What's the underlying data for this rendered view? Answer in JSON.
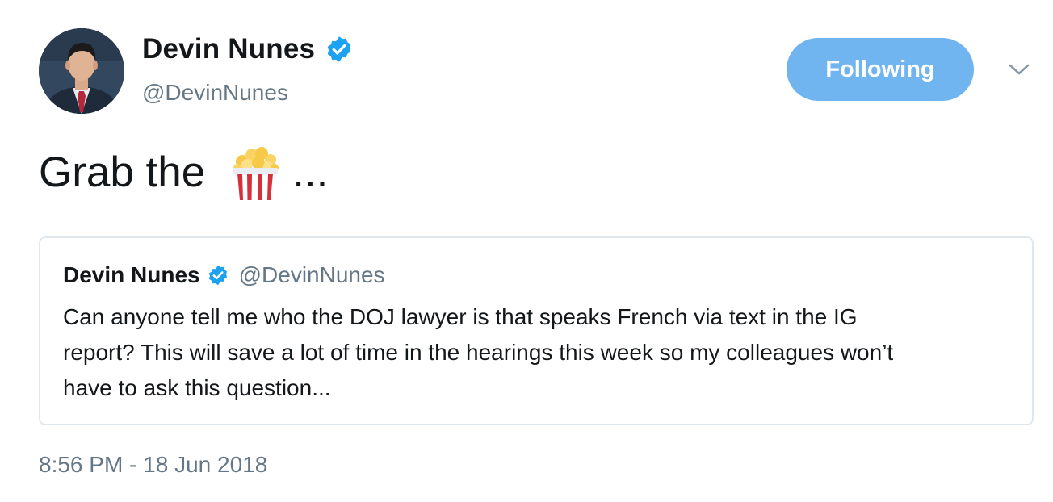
{
  "author": {
    "name": "Devin Nunes",
    "handle": "@DevinNunes",
    "avatar_icon": "profile-photo-man-suit-tie",
    "verified_icon": "verified-badge-icon",
    "verified_color": "#1da1f2"
  },
  "follow_button": {
    "label": "Following",
    "color": "#70b5ef"
  },
  "menu": {
    "icon": "chevron-down-icon"
  },
  "tweet": {
    "text_before": "Grab the",
    "emoji_icon": "popcorn-icon",
    "text_after": "..."
  },
  "quoted_tweet": {
    "name": "Devin Nunes",
    "handle": "@DevinNunes",
    "lines": [
      "Can anyone tell me who the DOJ lawyer is that speaks French via text in the IG",
      "report?  This will save a lot of time in the hearings this week so my colleagues won’t",
      "have to ask this question..."
    ]
  },
  "timestamp": "8:56 PM - 18 Jun 2018",
  "colors": {
    "text_primary": "#14171a",
    "text_secondary": "#657786",
    "border": "#e1e8ed"
  }
}
